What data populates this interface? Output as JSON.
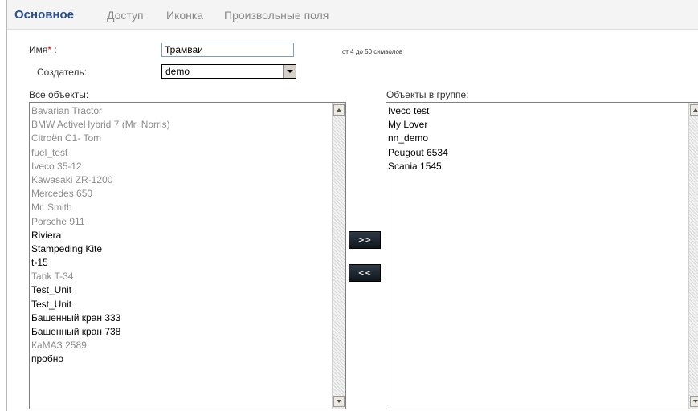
{
  "tabs": [
    {
      "label": "Основное"
    },
    {
      "label": "Доступ"
    },
    {
      "label": "Иконка"
    },
    {
      "label": "Произвольные поля"
    }
  ],
  "form": {
    "name_label": "Имя",
    "name_required_mark": "*",
    "name_colon": " :",
    "name_value": "Трамваи",
    "name_hint": "от 4 до 50 символов",
    "creator_label": "Создатель:",
    "creator_value": "demo"
  },
  "all_objects": {
    "label": "Все объекты:",
    "items": [
      {
        "text": "Bavarian Tractor",
        "muted": true
      },
      {
        "text": "BMW ActiveHybrid 7 (Mr. Norris)",
        "muted": true
      },
      {
        "text": "Citroën C1- Tom",
        "muted": true
      },
      {
        "text": "fuel_test",
        "muted": true
      },
      {
        "text": "Iveco 35-12",
        "muted": true
      },
      {
        "text": "Kawasaki ZR-1200",
        "muted": true
      },
      {
        "text": "Mercedes 650",
        "muted": true
      },
      {
        "text": "Mr. Smith",
        "muted": true
      },
      {
        "text": "Porsche 911",
        "muted": true
      },
      {
        "text": "Riviera",
        "muted": false
      },
      {
        "text": "Stampeding Kite",
        "muted": false
      },
      {
        "text": "t-15",
        "muted": false
      },
      {
        "text": "Tank T-34",
        "muted": true
      },
      {
        "text": "Test_Unit",
        "muted": false
      },
      {
        "text": "Test_Unit",
        "muted": false
      },
      {
        "text": "Башенный кран 333",
        "muted": false
      },
      {
        "text": "Башенный кран 738",
        "muted": false
      },
      {
        "text": "КаМАЗ 2589",
        "muted": true
      },
      {
        "text": "пробно",
        "muted": false
      }
    ]
  },
  "group_objects": {
    "label": "Объекты в группе:",
    "items": [
      {
        "text": "Iveco test"
      },
      {
        "text": "My Lover"
      },
      {
        "text": "nn_demo"
      },
      {
        "text": "Peugout 6534"
      },
      {
        "text": "Scania 1545"
      }
    ]
  },
  "buttons": {
    "add_label": ">>",
    "remove_label": "<<"
  },
  "colors": {
    "active_tab": "#2a4f8f",
    "inactive_tab": "#8a8a8a",
    "muted_item": "#8c8c8c",
    "required": "#e00000"
  }
}
